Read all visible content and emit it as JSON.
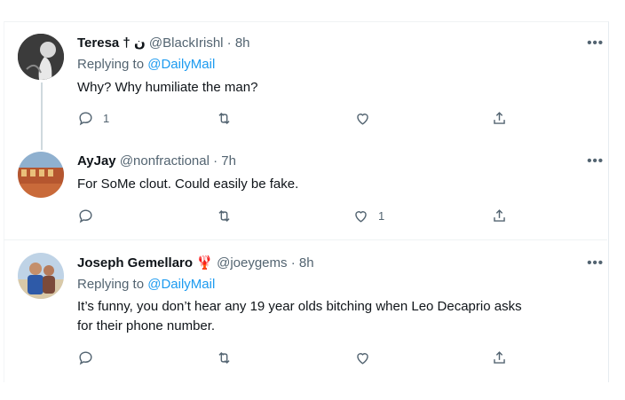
{
  "tweets": [
    {
      "name": "Teresa † ن",
      "handle": "@BlackIrishl",
      "dot": "·",
      "time": "8h",
      "replying_label": "Replying to",
      "replying_to": "@DailyMail",
      "text": "Why? Why humiliate the man?",
      "reply_count": "1",
      "like_count": "",
      "more": "•••"
    },
    {
      "name": "AyJay",
      "handle": "@nonfractional",
      "dot": "·",
      "time": "7h",
      "text": "For SoMe clout. Could easily be fake.",
      "reply_count": "",
      "like_count": "1",
      "more": "•••"
    },
    {
      "name": "Joseph Gemellaro",
      "badge_emoji": "🦞",
      "handle": "@joeygems",
      "dot": "·",
      "time": "8h",
      "replying_label": "Replying to",
      "replying_to": "@DailyMail",
      "text_line1": "It’s funny, you don’t hear any 19 year olds bitching when Leo Decaprio asks",
      "text_line2": "for their phone number.",
      "reply_count": "",
      "like_count": "",
      "more": "•••"
    }
  ],
  "icons": [
    "reply-icon",
    "retweet-icon",
    "like-icon",
    "share-icon",
    "more-icon",
    "lobster-icon"
  ],
  "colors": {
    "link": "#1d9bf0",
    "muted": "#536471",
    "text": "#0f1419",
    "divider": "#eff3f4"
  }
}
